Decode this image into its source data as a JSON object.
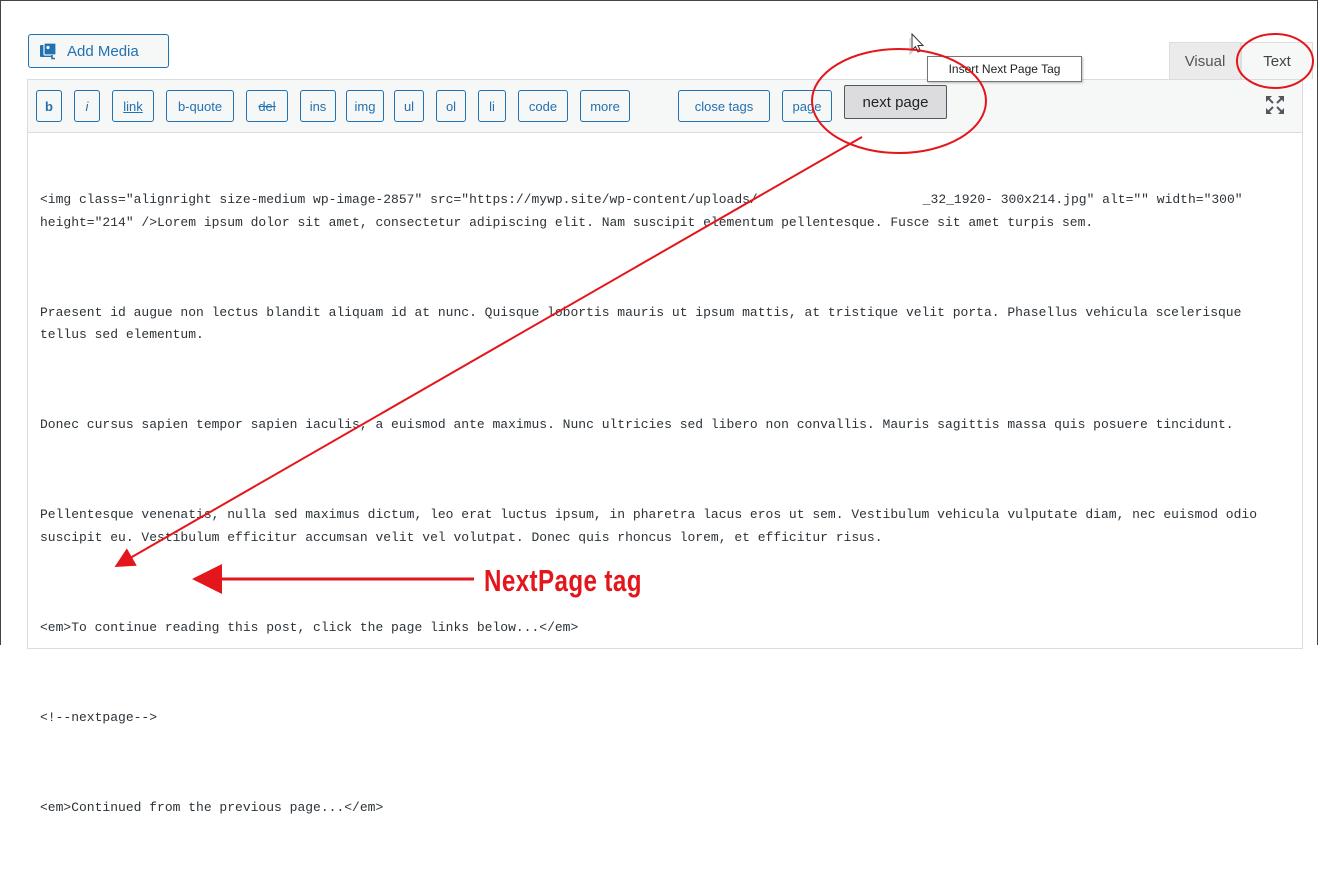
{
  "header": {
    "add_media_label": "Add Media",
    "tabs": {
      "visual": "Visual",
      "text": "Text"
    }
  },
  "toolbar": {
    "buttons": [
      "b",
      "i",
      "link",
      "b-quote",
      "del",
      "ins",
      "img",
      "ul",
      "ol",
      "li",
      "code",
      "more",
      "close tags",
      "page"
    ],
    "next_page_label": "next page",
    "tooltip": "Insert Next Page Tag"
  },
  "content": {
    "lines": [
      "<img class=\"alignright size-medium wp-image-2857\" src=\"https://mywp.site/wp-content/uploads/",
      "_32_1920-",
      "300x214.jpg\" alt=\"\" width=\"300\" height=\"214\" />Lorem ipsum dolor sit amet, consectetur adipiscing elit. Nam suscipit elementum pellentesque. Fusce sit amet turpis sem.",
      "Praesent id augue non lectus blandit aliquam id at nunc. Quisque lobortis mauris ut ipsum mattis, at tristique velit porta. Phasellus vehicula scelerisque tellus sed elementum.",
      "Donec cursus sapien tempor sapien iaculis, a euismod ante maximus. Nunc ultricies sed libero non convallis. Mauris sagittis massa quis posuere tincidunt.",
      "Pellentesque venenatis, nulla sed maximus dictum, leo erat luctus ipsum, in pharetra lacus eros ut sem. Vestibulum vehicula vulputate diam, nec euismod odio suscipit eu. Vestibulum efficitur accumsan velit vel volutpat. Donec quis rhoncus lorem, et efficitur risus.",
      "<em>To continue reading this post, click the page links below...</em>",
      "<!--nextpage-->",
      "<em>Continued from the previous page...</em>"
    ]
  },
  "annotation": {
    "label": "NextPage tag",
    "color": "#e3161c"
  },
  "colors": {
    "wp_blue": "#2271b1",
    "toolbar_bg": "#f6f7f7",
    "text": "#2c3338"
  }
}
